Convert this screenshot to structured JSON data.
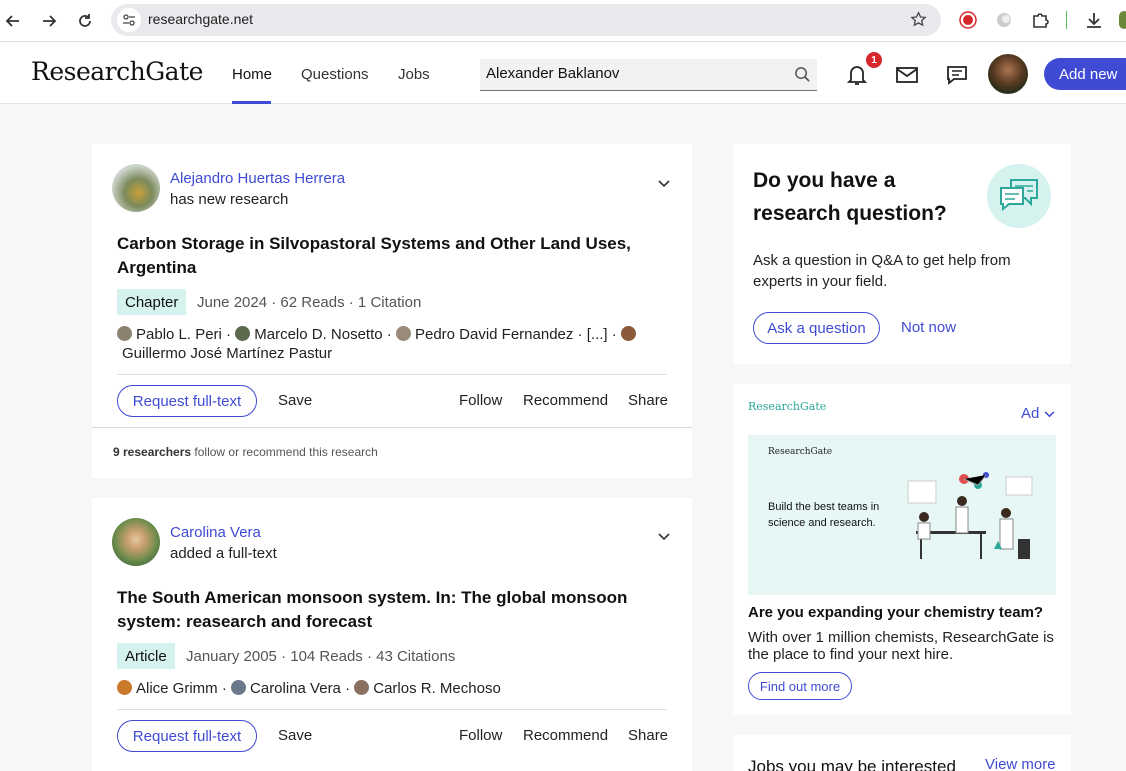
{
  "browser": {
    "url": "researchgate.net"
  },
  "header": {
    "logo": "ResearchGate",
    "tabs": [
      {
        "label": "Home",
        "active": true
      },
      {
        "label": "Questions",
        "active": false
      },
      {
        "label": "Jobs",
        "active": false
      }
    ],
    "search_value": "Alexander Baklanov",
    "notification_count": "1",
    "add_new_label": "Add new"
  },
  "feed": [
    {
      "author": "Alejandro Huertas Herrera",
      "action": "has new research",
      "title_line1": "Carbon Storage in Silvopastoral Systems and Other Land Uses,",
      "title_line2": "Argentina",
      "type": "Chapter",
      "meta": "June 2024 · 62 Reads · 1 Citation",
      "authors_line1": [
        "Pablo L. Peri",
        "Marcelo D. Nosetto",
        "Pedro David Fernandez",
        "[...]"
      ],
      "authors_line2": "Guillermo José Martínez Pastur",
      "request_label": "Request full-text",
      "save_label": "Save",
      "follow_label": "Follow",
      "recommend_label": "Recommend",
      "share_label": "Share",
      "footer_count": "9 researchers",
      "footer_text": "follow or recommend this research"
    },
    {
      "author": "Carolina Vera",
      "action": "added a full-text",
      "title_line1": "The South American monsoon system. In: The global monsoon",
      "title_line2": "system: reasearch and forecast",
      "type": "Article",
      "meta": "January 2005 · 104 Reads · 43 Citations",
      "authors_line1": [
        "Alice Grimm",
        "Carolina Vera",
        "Carlos R. Mechoso"
      ],
      "request_label": "Request full-text",
      "save_label": "Save",
      "follow_label": "Follow",
      "recommend_label": "Recommend",
      "share_label": "Share"
    }
  ],
  "question_card": {
    "title_line1": "Do you have a",
    "title_line2": "research question?",
    "body_line1": "Ask a question in Q&A to get help from",
    "body_line2": "experts in your field.",
    "ask_label": "Ask a question",
    "not_now_label": "Not now"
  },
  "ad_card": {
    "brand": "ResearchGate",
    "ad_label": "Ad",
    "image_brand": "ResearchGate",
    "image_text_line1": "Build the best teams in",
    "image_text_line2": "science and research.",
    "headline": "Are you expanding your chemistry team?",
    "body_line1": "With over 1 million chemists, ResearchGate is",
    "body_line2": "the place to find your next hire.",
    "cta_label": "Find out more"
  },
  "jobs_card": {
    "title": "Jobs you may be interested",
    "view_more_label": "View more"
  },
  "colors": {
    "accent": "#3f4bd4",
    "badge_bg": "#d6f2ef",
    "notification": "#d8262d",
    "ad_brand": "#2ba89a"
  }
}
